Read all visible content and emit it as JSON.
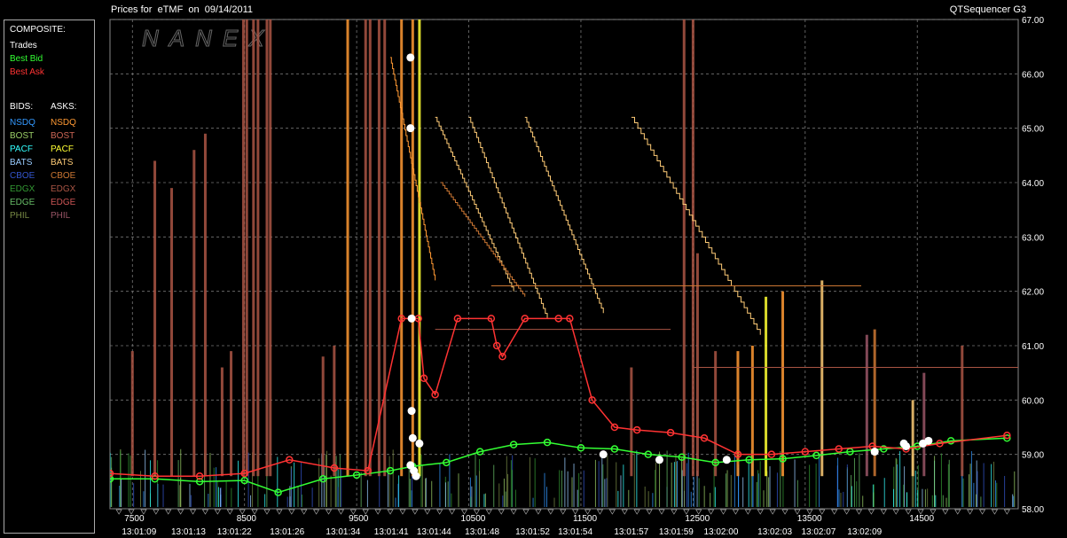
{
  "header": {
    "title_left": "Prices for  eTMF  on  09/14/2011",
    "title_right": "QTSequencer G3",
    "watermark": "NANEX"
  },
  "legend": {
    "composite_label": "COMPOSITE:",
    "composite_items": [
      {
        "label": "Trades",
        "color": "#ffffff"
      },
      {
        "label": "Best Bid",
        "color": "#33ff33"
      },
      {
        "label": "Best Ask",
        "color": "#ff3333"
      }
    ],
    "bids_label": "BIDS:",
    "asks_label": "ASKS:",
    "exchanges": [
      {
        "bid": "NSDQ",
        "bid_color": "#3399ff",
        "ask": "NSDQ",
        "ask_color": "#ff9933"
      },
      {
        "bid": "BOST",
        "bid_color": "#99cc66",
        "ask": "BOST",
        "ask_color": "#cc6655"
      },
      {
        "bid": "PACF",
        "bid_color": "#33ffff",
        "ask": "PACF",
        "ask_color": "#ffff33"
      },
      {
        "bid": "BATS",
        "bid_color": "#99ccff",
        "ask": "BATS",
        "ask_color": "#ffcc77"
      },
      {
        "bid": "CBOE",
        "bid_color": "#3355cc",
        "ask": "CBOE",
        "ask_color": "#cc7733"
      },
      {
        "bid": "EDGX",
        "bid_color": "#339933",
        "ask": "EDGX",
        "ask_color": "#aa5544"
      },
      {
        "bid": "EDGE",
        "bid_color": "#66bb66",
        "ask": "EDGE",
        "ask_color": "#cc5555"
      },
      {
        "bid": "PHIL",
        "bid_color": "#778844",
        "ask": "PHIL",
        "ask_color": "#995566"
      }
    ]
  },
  "chart_data": {
    "type": "line",
    "title": "Prices for  eTMF  on  09/14/2011",
    "ylim": [
      58.0,
      67.0
    ],
    "y_ticks": [
      "58.00",
      "59.00",
      "60.00",
      "61.00",
      "62.00",
      "63.00",
      "64.00",
      "65.00",
      "66.00",
      "67.00"
    ],
    "xlim": [
      7300,
      15400
    ],
    "x_seq_ticks": [
      7500,
      8500,
      9500,
      10500,
      11500,
      12500,
      13500,
      14500
    ],
    "x_time_ticks": [
      {
        "x": 7540,
        "label": "13:01:09"
      },
      {
        "x": 7980,
        "label": "13:01:13"
      },
      {
        "x": 8390,
        "label": "13:01:22"
      },
      {
        "x": 8860,
        "label": "13:01:26"
      },
      {
        "x": 9360,
        "label": "13:01:34"
      },
      {
        "x": 9790,
        "label": "13:01:41"
      },
      {
        "x": 10170,
        "label": "13:01:44"
      },
      {
        "x": 10600,
        "label": "13:01:48"
      },
      {
        "x": 11050,
        "label": "13:01:52"
      },
      {
        "x": 11430,
        "label": "13:01:54"
      },
      {
        "x": 11930,
        "label": "13:01:57"
      },
      {
        "x": 12330,
        "label": "13:01:59"
      },
      {
        "x": 12730,
        "label": "13:02:00"
      },
      {
        "x": 13210,
        "label": "13:02:03"
      },
      {
        "x": 13600,
        "label": "13:02:07"
      },
      {
        "x": 14010,
        "label": "13:02:09"
      }
    ],
    "grid": true,
    "series": [
      {
        "name": "Best Bid",
        "color": "#33ff33",
        "x": [
          7300,
          7700,
          8100,
          8500,
          8800,
          9200,
          9500,
          9800,
          10000,
          10300,
          10600,
          10900,
          11200,
          11500,
          11800,
          12100,
          12400,
          12700,
          13000,
          13300,
          13600,
          13900,
          14200,
          14500,
          14800,
          15300
        ],
        "y": [
          58.55,
          58.55,
          58.5,
          58.52,
          58.3,
          58.55,
          58.62,
          58.7,
          58.78,
          58.85,
          59.05,
          59.18,
          59.22,
          59.12,
          59.1,
          59.0,
          58.95,
          58.85,
          58.9,
          58.92,
          58.98,
          59.05,
          59.1,
          59.15,
          59.25,
          59.3
        ]
      },
      {
        "name": "Best Ask",
        "color": "#ff3333",
        "x": [
          7300,
          7700,
          8100,
          8500,
          8900,
          9300,
          9600,
          9900,
          10050,
          10100,
          10200,
          10400,
          10700,
          10750,
          10800,
          11000,
          11300,
          11400,
          11600,
          11800,
          12000,
          12300,
          12600,
          12900,
          13200,
          13500,
          13800,
          14100,
          14400,
          14700,
          15300
        ],
        "y": [
          58.65,
          58.6,
          58.6,
          58.65,
          58.9,
          58.75,
          58.7,
          61.5,
          61.5,
          60.4,
          60.1,
          61.5,
          61.5,
          61.0,
          60.8,
          61.5,
          61.5,
          61.5,
          60.0,
          59.5,
          59.45,
          59.4,
          59.3,
          59.0,
          59.0,
          59.05,
          59.1,
          59.15,
          59.1,
          59.2,
          59.35
        ]
      },
      {
        "name": "Trades",
        "color": "#ffffff",
        "x": [
          9980,
          9980,
          9990,
          9990,
          10000,
          9980,
          10010,
          10030,
          10060,
          11700,
          12200,
          12800,
          14120,
          14380,
          14400,
          14550,
          14600
        ],
        "y": [
          66.3,
          65.0,
          61.5,
          59.8,
          59.3,
          58.8,
          58.7,
          58.6,
          59.2,
          59.0,
          58.9,
          58.9,
          59.05,
          59.2,
          59.15,
          59.2,
          59.25
        ]
      }
    ]
  }
}
